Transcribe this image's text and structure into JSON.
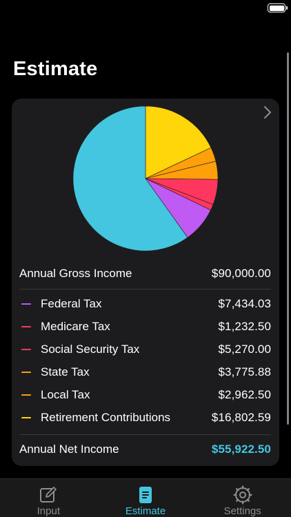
{
  "page": {
    "title": "Estimate"
  },
  "summary": {
    "gross": {
      "label": "Annual Gross Income",
      "value": "$90,000.00"
    },
    "items": [
      {
        "label": "Federal Tax",
        "value": "$7,434.03",
        "color": "#bf5af2",
        "amount": 7434.03
      },
      {
        "label": "Medicare Tax",
        "value": "$1,232.50",
        "color": "#ff375f",
        "amount": 1232.5
      },
      {
        "label": "Social Security Tax",
        "value": "$5,270.00",
        "color": "#ff375f",
        "amount": 5270.0
      },
      {
        "label": "State Tax",
        "value": "$3,775.88",
        "color": "#ff9f0a",
        "amount": 3775.88
      },
      {
        "label": "Local Tax",
        "value": "$2,962.50",
        "color": "#ff9f0a",
        "amount": 2962.5
      },
      {
        "label": "Retirement Contributions",
        "value": "$16,802.59",
        "color": "#ffd60a",
        "amount": 16802.59
      }
    ],
    "net": {
      "label": "Annual Net Income",
      "value": "$55,922.50",
      "color": "#45c6e0",
      "amount": 55922.5
    }
  },
  "tabs": [
    {
      "label": "Input",
      "icon": "edit-icon",
      "active": false
    },
    {
      "label": "Estimate",
      "icon": "document-icon",
      "active": true
    },
    {
      "label": "Settings",
      "icon": "gear-icon",
      "active": false
    }
  ]
}
